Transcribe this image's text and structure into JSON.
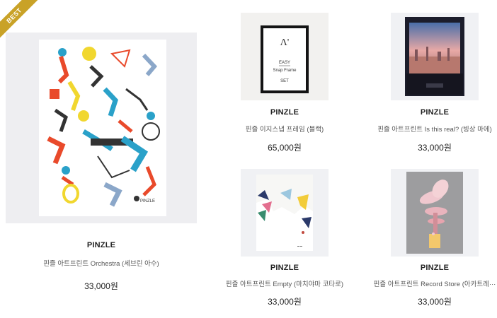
{
  "products": [
    {
      "badge": "BEST",
      "brand": "PINZLE",
      "name": "핀즐 아트프린트 Orchestra (세브린 아수)",
      "price": "33,000원"
    },
    {
      "brand": "PINZLE",
      "name": "핀즐 이지스냅 프레임 (블랙)",
      "price": "65,000원",
      "image_text": {
        "line1": "Λ'",
        "line2": "EASY",
        "line3": "Snap Frame",
        "line4": "SET"
      }
    },
    {
      "brand": "PINZLE",
      "name": "핀즐 아트프린트 Is this real? (빙상 마에)",
      "price": "33,000원"
    },
    {
      "brand": "PINZLE",
      "name": "핀즐 아트프린트 Empty (마치야마 코타로)",
      "price": "33,000원"
    },
    {
      "brand": "PINZLE",
      "name": "핀즐 아트프린트 Record Store (아카트레···",
      "price": "33,000원"
    }
  ]
}
